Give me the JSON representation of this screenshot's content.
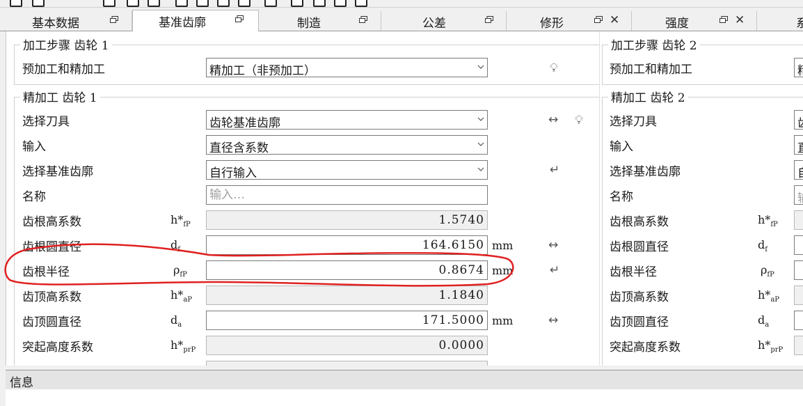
{
  "tabs": [
    {
      "label": "基本数据",
      "active": false,
      "floatable": true,
      "closable": false
    },
    {
      "label": "基准齿廓",
      "active": true,
      "floatable": true,
      "closable": false
    },
    {
      "label": "制造",
      "active": false,
      "floatable": true,
      "closable": false
    },
    {
      "label": "公差",
      "active": false,
      "floatable": true,
      "closable": false
    },
    {
      "label": "修形",
      "active": false,
      "floatable": true,
      "closable": true
    },
    {
      "label": "强度",
      "active": false,
      "floatable": true,
      "closable": true
    },
    {
      "label": "系",
      "active": false,
      "floatable": false,
      "closable": false
    }
  ],
  "gear1": {
    "process_title": "加工步骤 齿轮 1",
    "process_label": "预加工和精加工",
    "process_value": "精加工（非预加工）",
    "finish_title": "精加工 齿轮 1",
    "tool_label": "选择刀具",
    "tool_value": "齿轮基准齿廓",
    "input_label": "输入",
    "input_value": "直径含系数",
    "profile_label": "选择基准齿廓",
    "profile_value": "自行输入",
    "name_label": "名称",
    "name_placeholder": "输入…",
    "rows": [
      {
        "label": "齿根高系数",
        "sym_main": "h*",
        "sym_sub": "fP",
        "value": "1.5740",
        "unit": "",
        "readonly": true
      },
      {
        "label": "齿根圆直径",
        "sym_main": "d",
        "sym_sub": "f",
        "value": "164.6150",
        "unit": "mm",
        "readonly": false
      },
      {
        "label": "齿根半径",
        "sym_main": "ρ",
        "sym_sub": "fP",
        "value": "0.8674",
        "unit": "mm",
        "readonly": false
      },
      {
        "label": "齿顶高系数",
        "sym_main": "h*",
        "sym_sub": "aP",
        "value": "1.1840",
        "unit": "",
        "readonly": true
      },
      {
        "label": "齿顶圆直径",
        "sym_main": "d",
        "sym_sub": "a",
        "value": "171.5000",
        "unit": "mm",
        "readonly": false
      },
      {
        "label": "突起高度系数",
        "sym_main": "h*",
        "sym_sub": "prP",
        "value": "0.0000",
        "unit": "",
        "readonly": true
      }
    ]
  },
  "gear2": {
    "process_title": "加工步骤 齿轮 2",
    "process_label": "预加工和精加工",
    "process_value": "精",
    "finish_title": "精加工 齿轮 2",
    "tool_label": "选择刀具",
    "tool_value": "齿",
    "input_label": "输入",
    "input_value": "直",
    "profile_label": "选择基准齿廓",
    "profile_value": "自",
    "name_label": "名称",
    "name_placeholder": "输",
    "rows": [
      {
        "label": "齿根高系数",
        "sym_main": "h*",
        "sym_sub": "fP"
      },
      {
        "label": "齿根圆直径",
        "sym_main": "d",
        "sym_sub": "f"
      },
      {
        "label": "齿根半径",
        "sym_main": "ρ",
        "sym_sub": "fP"
      },
      {
        "label": "齿顶高系数",
        "sym_main": "h*",
        "sym_sub": "aP"
      },
      {
        "label": "齿顶圆直径",
        "sym_main": "d",
        "sym_sub": "a"
      },
      {
        "label": "突起高度系数",
        "sym_main": "h*",
        "sym_sub": "prP"
      }
    ]
  },
  "info_panel": {
    "title": "信息"
  },
  "icons": {
    "hint": "lightbulb-icon",
    "link": "double-arrow-icon",
    "enter": "return-arrow-icon",
    "float": "restore-window-icon",
    "close": "close-icon"
  },
  "colors": {
    "annotation": "#e02020",
    "readonly_bg": "#f0f0f0"
  }
}
